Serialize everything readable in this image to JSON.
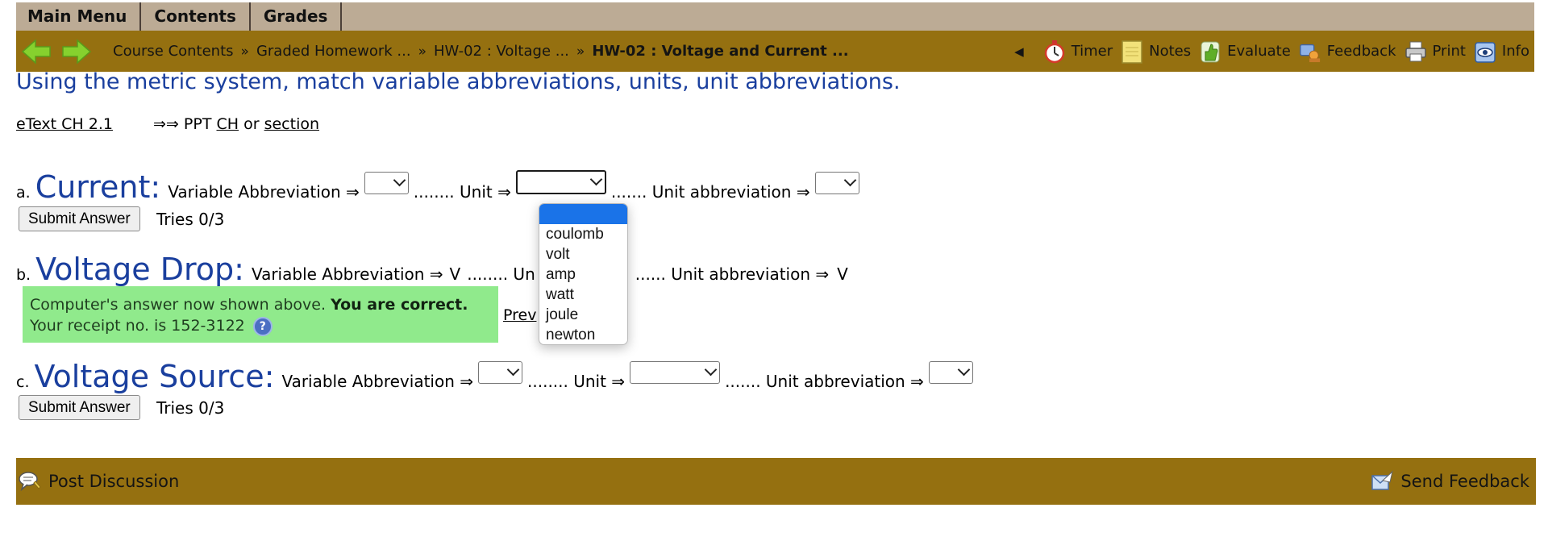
{
  "menu": {
    "tabs": [
      "Main Menu",
      "Contents",
      "Grades"
    ]
  },
  "breadcrumbs": [
    "Course Contents",
    "Graded Homework ...",
    "HW-02 : Voltage ...",
    "HW-02 : Voltage and Current ..."
  ],
  "breadcrumb_separator": "»",
  "tools": {
    "collapse": "◀",
    "items": [
      {
        "label": "Timer",
        "icon": "stopwatch-icon"
      },
      {
        "label": "Notes",
        "icon": "notepad-icon"
      },
      {
        "label": "Evaluate",
        "icon": "thumbs-up-icon"
      },
      {
        "label": "Feedback",
        "icon": "feedback-icon"
      },
      {
        "label": "Print",
        "icon": "printer-icon"
      },
      {
        "label": "Info",
        "icon": "info-eye-icon"
      }
    ]
  },
  "intro": "Using the metric system, match variable abbreviations, units, unit abbreviations.",
  "links": {
    "etext": "eText CH 2.1",
    "arrows": "⇒⇒",
    "ppt": "PPT",
    "ch": "CH",
    "or": "or",
    "section": "section"
  },
  "questions": {
    "a": {
      "letter": "a.",
      "title": "Current:",
      "var_label": "Variable Abbreviation ⇒",
      "unit_label": "........ Unit ⇒",
      "unit_abbr_label": "....... Unit abbreviation ⇒",
      "tries": "Tries 0/3"
    },
    "b": {
      "letter": "b.",
      "title": "Voltage Drop:",
      "var_label": "Variable Abbreviation ⇒",
      "var_value": "V",
      "unit_label": "........ Un",
      "unit_abbr_label": "...... Unit abbreviation ⇒",
      "unit_abbr_value": "V"
    },
    "c": {
      "letter": "c.",
      "title": "Voltage Source:",
      "var_label": "Variable Abbreviation ⇒",
      "unit_label": "........ Unit ⇒",
      "unit_abbr_label": "....... Unit abbreviation ⇒",
      "tries": "Tries 0/3"
    }
  },
  "submit_label": "Submit Answer",
  "result": {
    "line1": "Computer's answer now shown above.",
    "correct": "You are correct.",
    "line2": "Your receipt no. is 152-3122",
    "help": "?"
  },
  "prev_link": "Prev",
  "dropdown_options": [
    "",
    "coulomb",
    "volt",
    "amp",
    "watt",
    "joule",
    "newton"
  ],
  "footer": {
    "post": "Post Discussion",
    "send": "Send Feedback"
  },
  "colors": {
    "menu_bg": "#bcab95",
    "nav_bg": "#957010",
    "title_blue": "#1a3f9e",
    "correct_green": "#90ea8c",
    "highlight": "#1a73e8"
  }
}
